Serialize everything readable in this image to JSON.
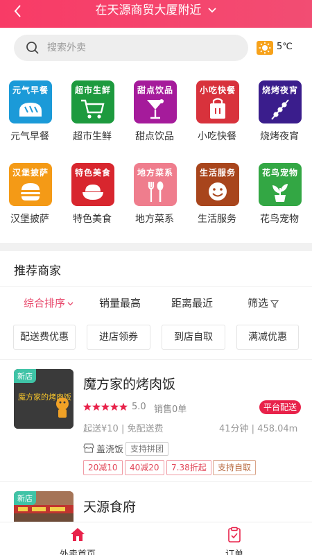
{
  "header": {
    "location": "在天源商贸大厦附近"
  },
  "search": {
    "placeholder": "搜索外卖"
  },
  "weather": {
    "icon": "sun-icon",
    "temp": "5℃"
  },
  "categories": [
    {
      "tile_text": "元气早餐",
      "label": "元气早餐",
      "color": "#1b9ad8",
      "icon": "bread-icon"
    },
    {
      "tile_text": "超市生鲜",
      "label": "超市生鲜",
      "color": "#1d9a3e",
      "icon": "shopping-cart-icon"
    },
    {
      "tile_text": "甜点饮品",
      "label": "甜点饮品",
      "color": "#a51b9b",
      "icon": "cocktail-icon"
    },
    {
      "tile_text": "小吃快餐",
      "label": "小吃快餐",
      "color": "#d8323c",
      "icon": "takeout-bag-icon"
    },
    {
      "tile_text": "烧烤夜宵",
      "label": "烧烤夜宵",
      "color": "#3a1d8c",
      "icon": "skewer-icon"
    },
    {
      "tile_text": "汉堡披萨",
      "label": "汉堡披萨",
      "color": "#f49a16",
      "icon": "burger-icon"
    },
    {
      "tile_text": "特色美食",
      "label": "特色美食",
      "color": "#d8262e",
      "icon": "rice-bowl-icon"
    },
    {
      "tile_text": "地方菜系",
      "label": "地方菜系",
      "color": "#ef7d8d",
      "icon": "fork-spoon-icon"
    },
    {
      "tile_text": "生活服务",
      "label": "生活服务",
      "color": "#a8451c",
      "icon": "smiley-icon"
    },
    {
      "tile_text": "花鸟宠物",
      "label": "花鸟宠物",
      "color": "#33a744",
      "icon": "plant-icon"
    }
  ],
  "recommend": {
    "title": "推荐商家"
  },
  "sort": [
    {
      "label": "综合排序"
    },
    {
      "label": "销量最高"
    },
    {
      "label": "距离最近"
    },
    {
      "label": "筛选"
    }
  ],
  "filters": [
    {
      "label": "配送费优惠"
    },
    {
      "label": "进店领券"
    },
    {
      "label": "到店自取"
    },
    {
      "label": "满减优惠"
    }
  ],
  "shops": [
    {
      "badge": "新店",
      "name": "魔方家的烤肉饭",
      "thumb_text": "魔方家的烤肉饭",
      "rating": "5.0",
      "sales": "销售0单",
      "delivery_tag": "平台配送",
      "min_order": "起送¥10 | 免配送费",
      "time_distance": "41分钟 | 458.04m",
      "type_icon": "store-icon",
      "type": "盖浇饭",
      "group_tag": "支持拼团",
      "promos": [
        "20减10",
        "40减20",
        "7.38折起",
        "支持自取"
      ]
    },
    {
      "badge": "新店",
      "name": "天源食府"
    }
  ],
  "tabbar": [
    {
      "label": "外卖首页",
      "icon": "home-icon"
    },
    {
      "label": "订单",
      "icon": "clipboard-icon"
    }
  ],
  "colors": {
    "brand": "#f83b66",
    "badge": "#3fc3a6",
    "platform": "#e8224a"
  }
}
